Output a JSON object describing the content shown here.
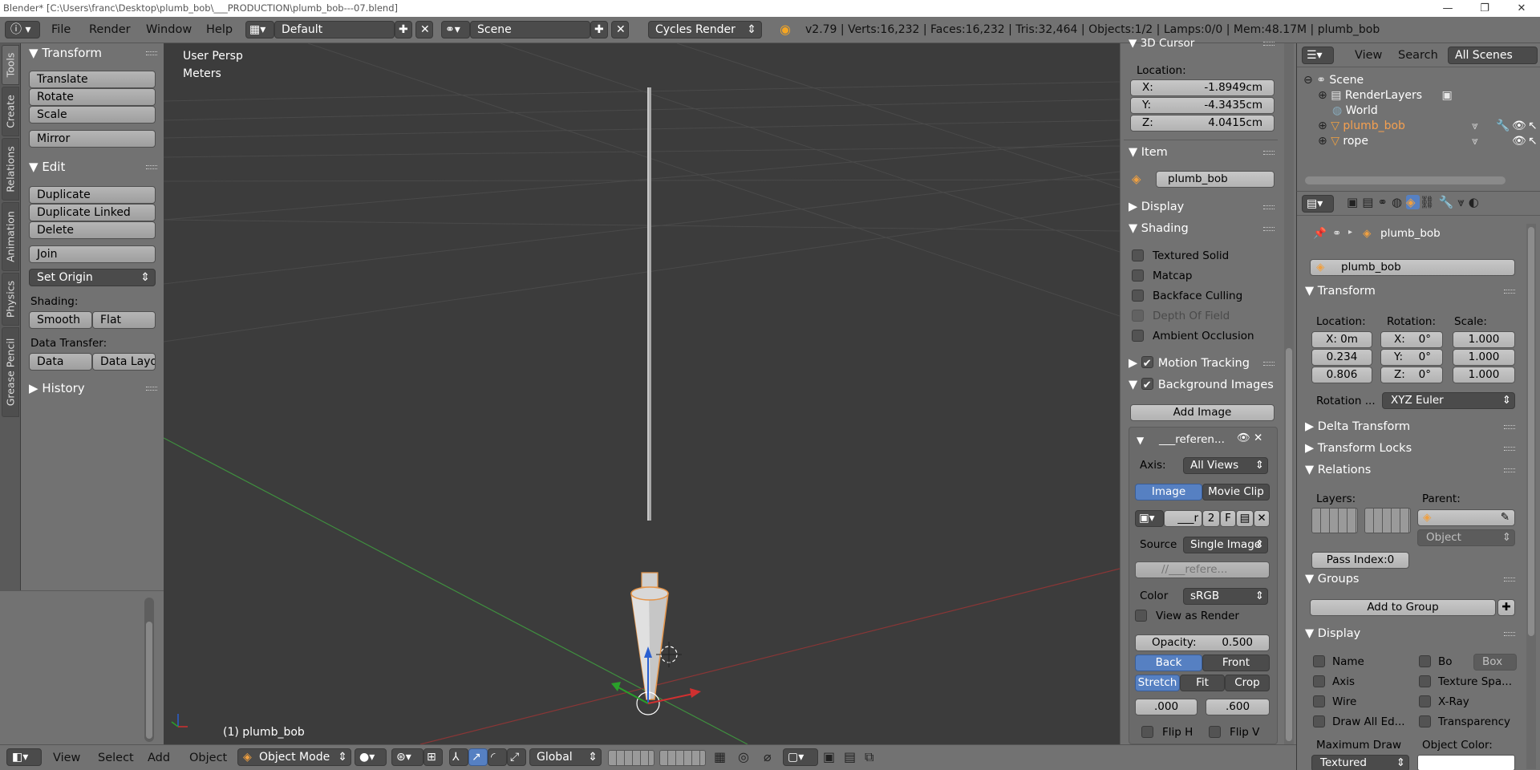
{
  "window": {
    "title": "Blender* [C:\\Users\\franc\\Desktop\\plumb_bob\\___PRODUCTION\\plumb_bob---07.blend]",
    "controls": [
      "—",
      "❐",
      "✕"
    ]
  },
  "info": {
    "menus": [
      "File",
      "Render",
      "Window",
      "Help"
    ],
    "layout": "Default",
    "scene": "Scene",
    "engine": "Cycles Render",
    "stats": "v2.79 | Verts:16,232 | Faces:16,232 | Tris:32,464 | Objects:1/2 | Lamps:0/0 | Mem:48.17M | plumb_bob"
  },
  "tabs": [
    "Tools",
    "Create",
    "Relations",
    "Animation",
    "Physics",
    "Grease Pencil"
  ],
  "tools": {
    "transform_header": "Transform",
    "translate": "Translate",
    "rotate": "Rotate",
    "scale": "Scale",
    "mirror": "Mirror",
    "edit_header": "Edit",
    "duplicate": "Duplicate",
    "duplicate_linked": "Duplicate Linked",
    "delete": "Delete",
    "join": "Join",
    "set_origin": "Set Origin",
    "shading_label": "Shading:",
    "smooth": "Smooth",
    "flat": "Flat",
    "data_transfer_label": "Data Transfer:",
    "data": "Data",
    "data_layout": "Data Layo",
    "history_header": "History"
  },
  "viewport": {
    "view_name": "User Persp",
    "units": "Meters",
    "object_label": "(1) plumb_bob"
  },
  "npanel": {
    "cursor_header": "3D Cursor",
    "location_label": "Location:",
    "x_label": "X:",
    "x_value": "-1.8949cm",
    "y_label": "Y:",
    "y_value": "-4.3435cm",
    "z_label": "Z:",
    "z_value": "4.0415cm",
    "item_header": "Item",
    "item_name": "plumb_bob",
    "display_header": "Display",
    "shading_header": "Shading",
    "textured_solid": "Textured Solid",
    "matcap": "Matcap",
    "backface_culling": "Backface Culling",
    "depth_of_field": "Depth Of Field",
    "ambient_occlusion": "Ambient Occlusion",
    "motion_tracking": "Motion Tracking",
    "background_images": "Background Images",
    "add_image": "Add Image",
    "ref_name": "___referen...",
    "axis_label": "Axis:",
    "axis_value": "All Views",
    "image_tab": "Image",
    "movie_clip_tab": "Movie Clip",
    "img_slot": "___r",
    "img_users": "2",
    "img_fake": "F",
    "source_label": "Source",
    "source_value": "Single Image",
    "filepath": "//___refere...",
    "color_label": "Color",
    "color_value": "sRGB",
    "view_as_render": "View as Render",
    "opacity_label": "Opacity:",
    "opacity_value": "0.500",
    "back": "Back",
    "front": "Front",
    "stretch": "Stretch",
    "fit": "Fit",
    "crop": "Crop",
    "offset_x": ".000",
    "offset_y": ".600",
    "flip_h": "Flip H",
    "flip_v": "Flip V"
  },
  "outliner": {
    "view": "View",
    "search": "Search",
    "filter": "All Scenes",
    "items": [
      "Scene",
      "RenderLayers",
      "World",
      "plumb_bob",
      "rope"
    ]
  },
  "properties": {
    "breadcrumb": "plumb_bob",
    "object_name": "plumb_bob",
    "transform_header": "Transform",
    "location_label": "Location:",
    "rotation_label": "Rotation:",
    "scale_label": "Scale:",
    "loc": [
      "X: 0m",
      "0.234",
      "0.806"
    ],
    "rot": [
      "X:",
      "Y:",
      "Z:"
    ],
    "rot_values": [
      "0°",
      "0°",
      "0°"
    ],
    "scale": [
      "1.000",
      "1.000",
      "1.000"
    ],
    "rotation_mode_label": "Rotation ...",
    "rotation_mode": "XYZ Euler",
    "delta_transform": "Delta Transform",
    "transform_locks": "Transform Locks",
    "relations_header": "Relations",
    "layers_label": "Layers:",
    "parent_label": "Parent:",
    "parent_type": "Object",
    "pass_index": "Pass Index:0",
    "groups_header": "Groups",
    "add_to_group": "Add to Group",
    "display_header": "Display",
    "name": "Name",
    "axis": "Axis",
    "wire": "Wire",
    "draw_all_edges": "Draw All Ed...",
    "bounds": "Bo",
    "bounds_type": "Box",
    "texture_space": "Texture Spa...",
    "xray": "X-Ray",
    "transparency": "Transparency",
    "max_draw_label": "Maximum Draw",
    "max_draw_value": "Textured",
    "object_color_label": "Object Color:"
  },
  "bottom": {
    "view": "View",
    "select": "Select",
    "add": "Add",
    "object": "Object",
    "mode": "Object Mode",
    "orientation": "Global"
  }
}
